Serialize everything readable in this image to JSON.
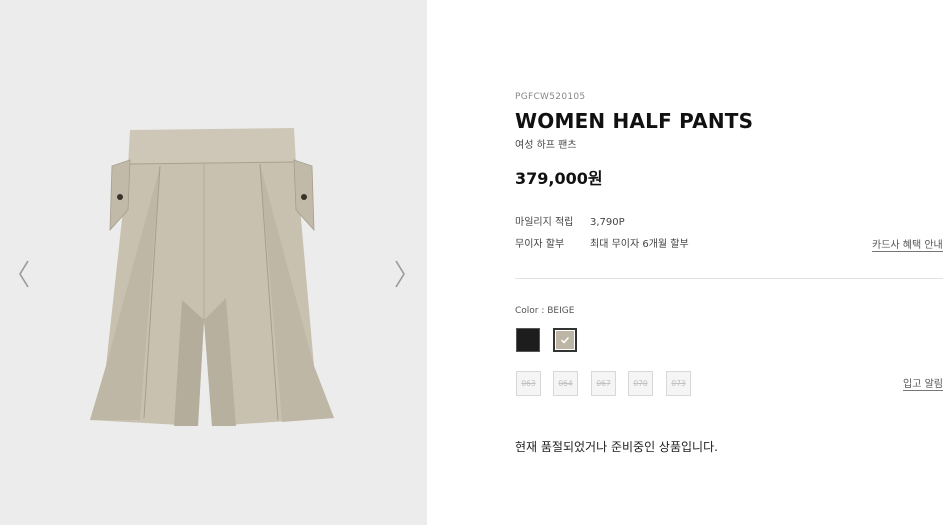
{
  "gallery": {
    "prev_icon": "chevron-left-icon",
    "next_icon": "chevron-right-icon"
  },
  "product": {
    "code": "PGFCW520105",
    "name": "WOMEN HALF PANTS",
    "name_ko": "여성 하프 팬츠",
    "price": "379,000원",
    "mileage_label": "마일리지 적립",
    "mileage_value": "3,790P",
    "installment_label": "무이자 할부",
    "installment_value": "최대 무이자 6개월 할부",
    "card_benefit_link": "카드사 혜택 안내"
  },
  "options": {
    "color_label": "Color : BEIGE",
    "colors": [
      {
        "name": "black",
        "hex": "#1d1d1d"
      },
      {
        "name": "beige",
        "hex": "#bdb5a6",
        "selected": true
      }
    ],
    "sizes": [
      "063",
      "064",
      "067",
      "070",
      "073"
    ],
    "notify_link": "입고 알림"
  },
  "status_message": "현재 품절되었거나 준비중인 상품입니다."
}
